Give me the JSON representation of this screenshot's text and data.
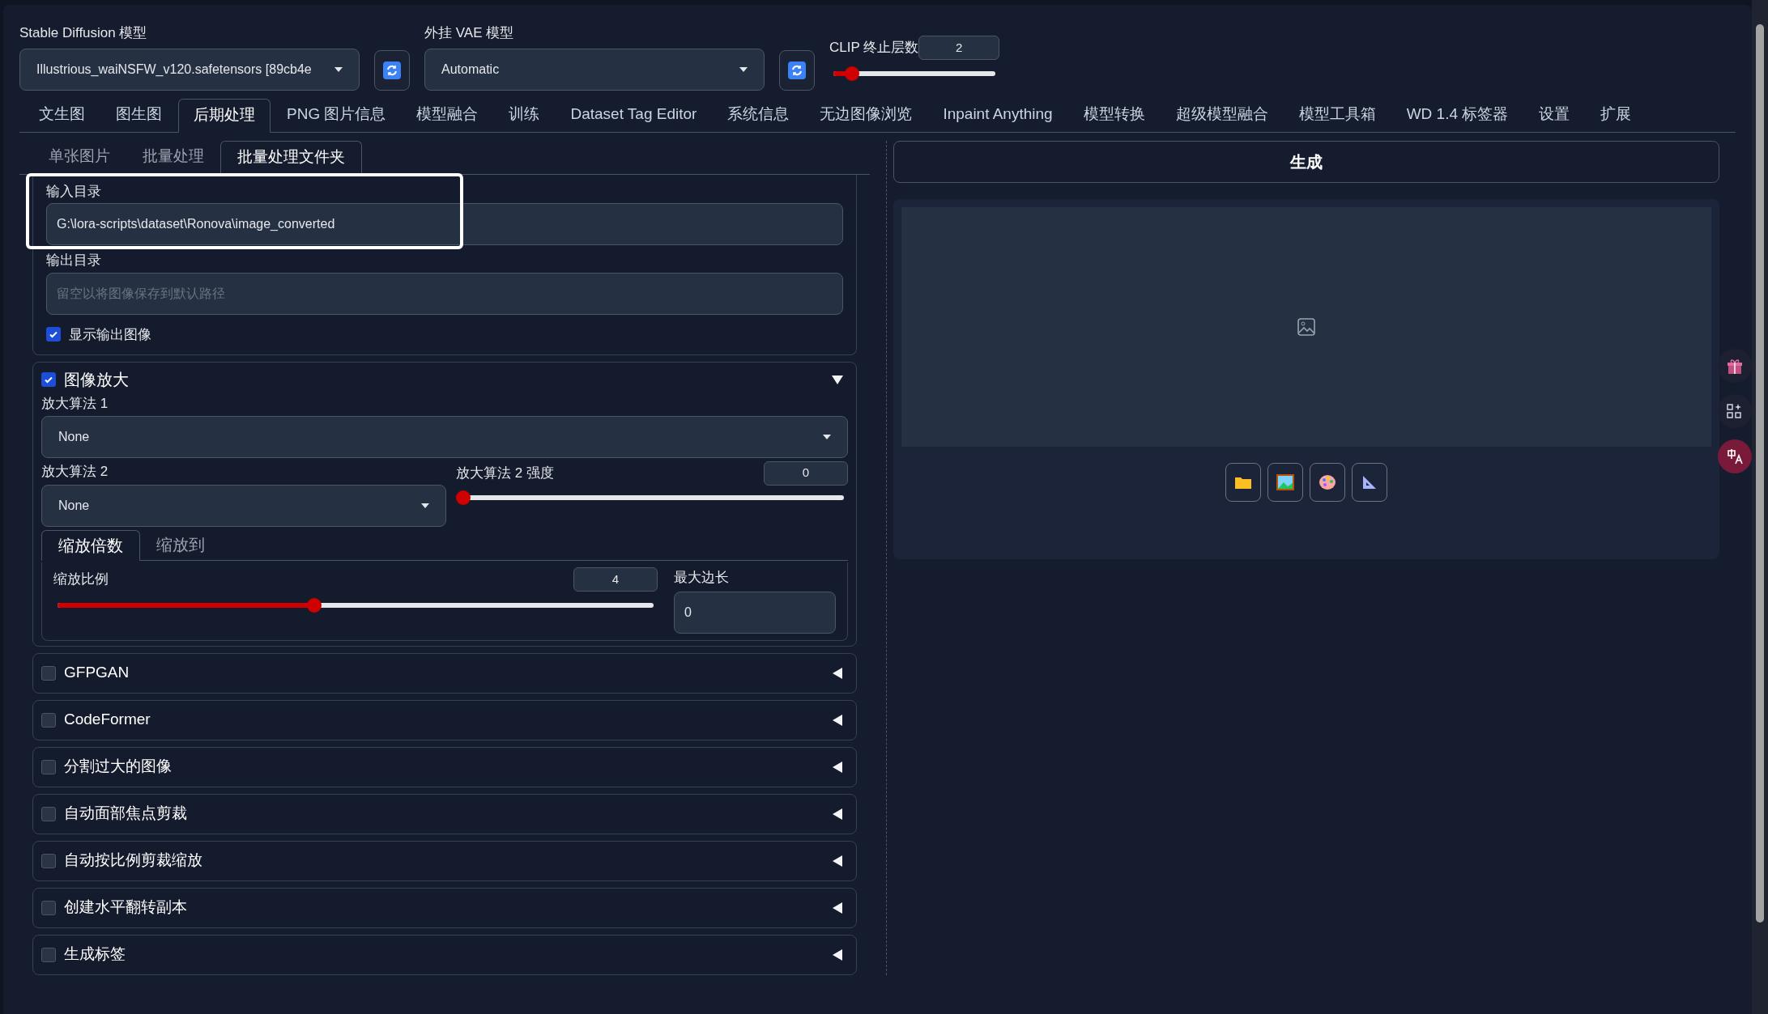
{
  "top": {
    "model": {
      "label": "Stable Diffusion 模型",
      "value": "Illustrious_waiNSFW_v120.safetensors [89cb4e"
    },
    "vae": {
      "label": "外挂 VAE 模型",
      "value": "Automatic"
    },
    "clip": {
      "label": "CLIP 终止层数",
      "value": "2",
      "level": 0.1
    }
  },
  "tabs": [
    {
      "label": "文生图",
      "selected": false
    },
    {
      "label": "图生图",
      "selected": false
    },
    {
      "label": "后期处理",
      "selected": true
    },
    {
      "label": "PNG 图片信息",
      "selected": false
    },
    {
      "label": "模型融合",
      "selected": false
    },
    {
      "label": "训练",
      "selected": false
    },
    {
      "label": "Dataset Tag Editor",
      "selected": false
    },
    {
      "label": "系统信息",
      "selected": false
    },
    {
      "label": "无边图像浏览",
      "selected": false
    },
    {
      "label": "Inpaint Anything",
      "selected": false
    },
    {
      "label": "模型转换",
      "selected": false
    },
    {
      "label": "超级模型融合",
      "selected": false
    },
    {
      "label": "模型工具箱",
      "selected": false
    },
    {
      "label": "WD 1.4 标签器",
      "selected": false
    },
    {
      "label": "设置",
      "selected": false
    },
    {
      "label": "扩展",
      "selected": false
    }
  ],
  "subtabs": [
    {
      "label": "单张图片",
      "selected": false
    },
    {
      "label": "批量处理",
      "selected": false
    },
    {
      "label": "批量处理文件夹",
      "selected": true
    }
  ],
  "input_dir": {
    "label": "输入目录",
    "value": "G:\\lora-scripts\\dataset\\Ronova\\image_converted"
  },
  "output_dir": {
    "label": "输出目录",
    "placeholder": "留空以将图像保存到默认路径"
  },
  "show_output": {
    "label": "显示输出图像",
    "checked": true
  },
  "upscale": {
    "title": "图像放大",
    "checked": true,
    "expanded": true,
    "upscaler1": {
      "label": "放大算法 1",
      "value": "None"
    },
    "upscaler2": {
      "label": "放大算法 2",
      "value": "None"
    },
    "strength": {
      "label": "放大算法 2 强度",
      "value": "0",
      "level": 0
    },
    "modes": [
      {
        "label": "缩放倍数",
        "selected": true
      },
      {
        "label": "缩放到",
        "selected": false
      }
    ],
    "scale": {
      "label": "缩放比例",
      "value": "4",
      "level": 0.43
    },
    "max_side": {
      "label": "最大边长",
      "value": "0"
    }
  },
  "sections": [
    {
      "title": "GFPGAN",
      "checked": false,
      "expanded": false
    },
    {
      "title": "CodeFormer",
      "checked": false,
      "expanded": false
    },
    {
      "title": "分割过大的图像",
      "checked": false,
      "expanded": false
    },
    {
      "title": "自动面部焦点剪裁",
      "checked": false,
      "expanded": false
    },
    {
      "title": "自动按比例剪裁缩放",
      "checked": false,
      "expanded": false
    },
    {
      "title": "创建水平翻转副本",
      "checked": false,
      "expanded": false
    },
    {
      "title": "生成标签",
      "checked": false,
      "expanded": false
    }
  ],
  "generate_button": "生成"
}
